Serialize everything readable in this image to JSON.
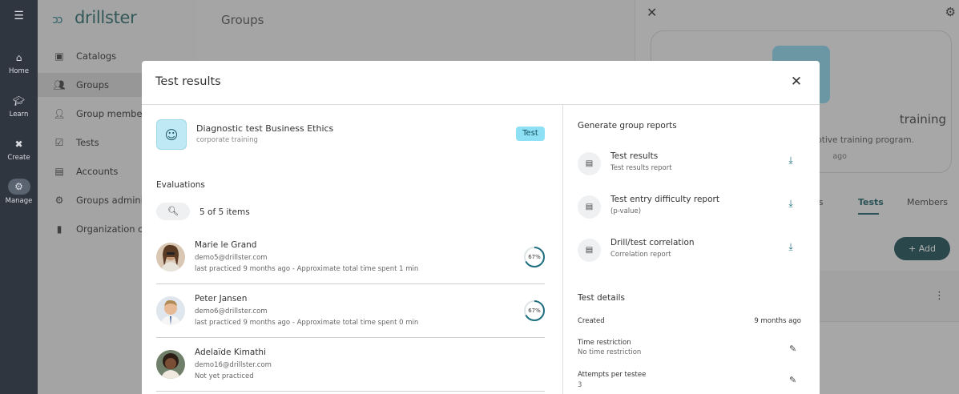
{
  "app": {
    "logo_text": "drillster",
    "logo_mark": "ɔɔ"
  },
  "rail": {
    "menu_icon": "menu-icon",
    "items": [
      {
        "label": "Home",
        "icon": "home-icon"
      },
      {
        "label": "Learn",
        "icon": "graduation-cap-icon"
      },
      {
        "label": "Create",
        "icon": "tools-icon"
      },
      {
        "label": "Manage",
        "icon": "manage-icon"
      }
    ]
  },
  "sidebar": {
    "items": [
      {
        "label": "Catalogs",
        "icon": "catalog-icon"
      },
      {
        "label": "Groups",
        "icon": "groups-icon"
      },
      {
        "label": "Group members",
        "icon": "group-members-icon"
      },
      {
        "label": "Tests",
        "icon": "tests-icon"
      },
      {
        "label": "Accounts",
        "icon": "accounts-icon"
      },
      {
        "label": "Groups administrators",
        "icon": "admin-icon"
      },
      {
        "label": "Organization configuration",
        "icon": "organization-icon"
      }
    ]
  },
  "main": {
    "title": "Groups"
  },
  "right_panel": {
    "title": "training",
    "description": "adaptive training program.",
    "ago": "ago",
    "tabs": [
      "ges",
      "Tests",
      "Members"
    ],
    "add_label": "+ Add"
  },
  "modal": {
    "title": "Test results",
    "test": {
      "name": "Diagnostic test Business Ethics",
      "category": "corporate training",
      "badge": "Test"
    },
    "evaluations_heading": "Evaluations",
    "count_text": "5 of 5 items",
    "evaluations": [
      {
        "name": "Marie le Grand",
        "email": "demo5@drillster.com",
        "meta": "last practiced 9 months ago - Approximate total time spent 1 min",
        "score": "67%",
        "score_value": 0.67
      },
      {
        "name": "Peter Jansen",
        "email": "demo6@drillster.com",
        "meta": "last practiced 9 months ago - Approximate total time spent 0 min",
        "score": "67%",
        "score_value": 0.67
      },
      {
        "name": "Adelaïde Kimathi",
        "email": "demo16@drillster.com",
        "meta": "Not yet practiced"
      }
    ],
    "reports_heading": "Generate group reports",
    "reports": [
      {
        "title": "Test results",
        "subtitle": "Test results report"
      },
      {
        "title": "Test entry difficulty report",
        "subtitle": "(p-value)"
      },
      {
        "title": "Drill/test correlation",
        "subtitle": "Correlation report"
      }
    ],
    "details_heading": "Test details",
    "details": [
      {
        "label": "Created",
        "value": "9 months ago"
      },
      {
        "label": "Time restriction",
        "value": "No time restriction"
      },
      {
        "label": "Attempts per testee",
        "value": "3"
      }
    ]
  },
  "colors": {
    "accent": "#1f6f80",
    "badge_bg": "#8ee0f5",
    "rail_bg": "#2f3640"
  }
}
